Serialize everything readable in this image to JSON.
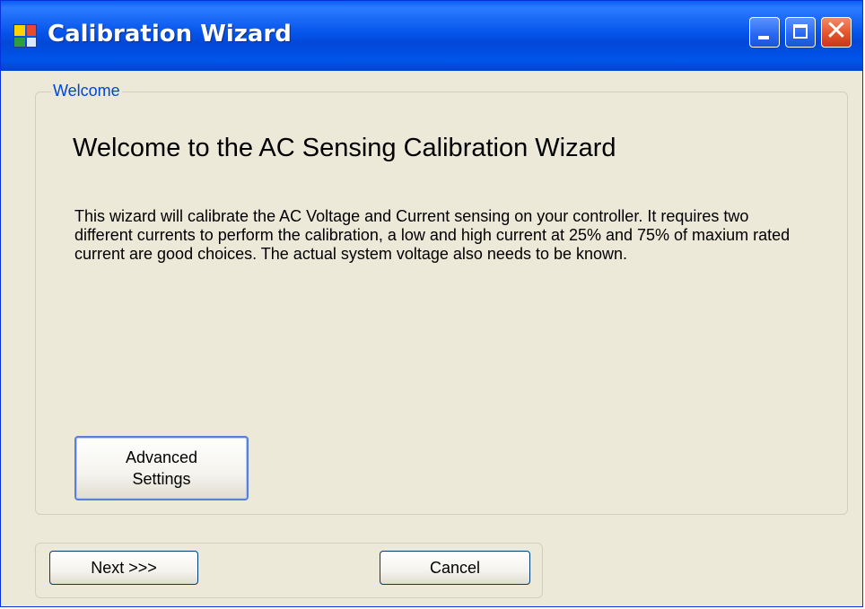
{
  "window": {
    "title": "Calibration Wizard",
    "icon": "app-window-icon",
    "controls": {
      "minimize": "minimize-icon",
      "maximize": "maximize-icon",
      "close": "✕"
    }
  },
  "group": {
    "legend": "Welcome",
    "heading": "Welcome to the AC Sensing Calibration Wizard",
    "description": "This wizard will calibrate the AC Voltage and Current sensing on your controller.  It requires two different currents to perform the calibration, a low and high current at 25% and 75% of maxium rated current are good choices.  The  actual system voltage also needs to be known.",
    "advanced_button": "Advanced\nSettings"
  },
  "footer": {
    "next_label": "Next >>>",
    "cancel_label": "Cancel"
  },
  "colors": {
    "titlebar": "#0055ea",
    "window_bg": "#ece9d8",
    "legend_text": "#0046d5",
    "close_button": "#e3532b"
  }
}
